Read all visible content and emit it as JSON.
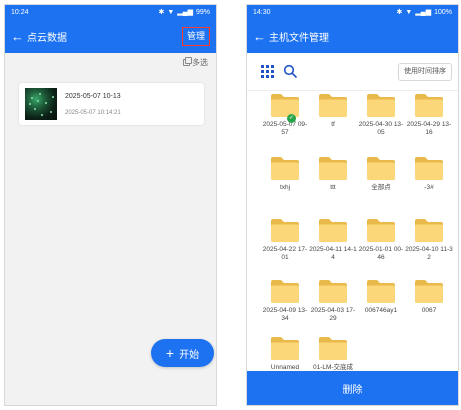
{
  "left": {
    "status": {
      "time": "10:24",
      "battery": "99%"
    },
    "title": "点云数据",
    "manage_label": "管理",
    "multiselect_label": "多选",
    "card": {
      "title": "2025-05-07 10-13",
      "time": "2025-05-07 10:14:21"
    },
    "start_label": "开始"
  },
  "right": {
    "status": {
      "time": "14:30",
      "battery": "100%"
    },
    "title": "主机文件管理",
    "sort_label": "使用时间排序",
    "folders": [
      {
        "name": "2025-05-07 09-57",
        "checked": true
      },
      {
        "name": "tf"
      },
      {
        "name": "2025-04-30 13-05"
      },
      {
        "name": "2025-04-29 13-16"
      },
      {
        "name": "txhj"
      },
      {
        "name": "ttt"
      },
      {
        "name": "全部点"
      },
      {
        "name": "-3#"
      },
      {
        "name": "2025-04-22 17-01"
      },
      {
        "name": "2025-04-11 14-14"
      },
      {
        "name": "2025-01-01 00-46"
      },
      {
        "name": "2025-04-10 11-32"
      },
      {
        "name": "2025-04-09 13-34"
      },
      {
        "name": "2025-04-03 17-29"
      },
      {
        "name": "006746ay1"
      },
      {
        "name": "0067"
      },
      {
        "name": "Unnamed"
      },
      {
        "name": "01-LM-交底成"
      }
    ],
    "delete_label": "删除"
  },
  "colors": {
    "primary": "#1d72f2",
    "folder": "#fbd77a",
    "highlight": "#ff3b30",
    "check": "#2aa64a"
  },
  "icons": [
    "back-arrow-icon",
    "grid-view-icon",
    "search-icon",
    "folder-icon",
    "check-icon",
    "plus-icon",
    "multiselect-icon"
  ]
}
